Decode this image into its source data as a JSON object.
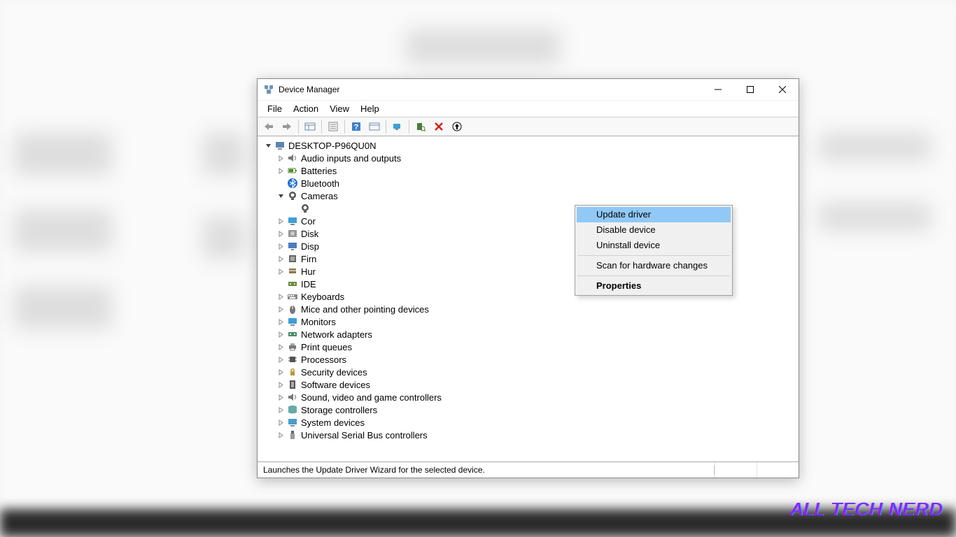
{
  "window": {
    "title": "Device Manager"
  },
  "menu": {
    "file": "File",
    "action": "Action",
    "view": "View",
    "help": "Help"
  },
  "root": {
    "label": "DESKTOP-P96QU0N"
  },
  "categories": [
    {
      "label": "Audio inputs and outputs",
      "expander": "right",
      "icon": "audio"
    },
    {
      "label": "Batteries",
      "expander": "right",
      "icon": "battery"
    },
    {
      "label": "Bluetooth",
      "expander": "none",
      "icon": "bluetooth"
    },
    {
      "label": "Cameras",
      "expander": "down",
      "icon": "camera"
    },
    {
      "label": "Cor",
      "expander": "right",
      "icon": "monitor",
      "truncated": true
    },
    {
      "label": "Disk",
      "expander": "right",
      "icon": "disk",
      "truncated": true
    },
    {
      "label": "Disp",
      "expander": "right",
      "icon": "display",
      "truncated": true
    },
    {
      "label": "Firn",
      "expander": "right",
      "icon": "firmware",
      "truncated": true
    },
    {
      "label": "Hur",
      "expander": "right",
      "icon": "hid",
      "truncated": true
    },
    {
      "label": "IDE",
      "expander": "none",
      "icon": "ide",
      "truncated": true
    },
    {
      "label": "Keyboards",
      "expander": "right",
      "icon": "keyboard"
    },
    {
      "label": "Mice and other pointing devices",
      "expander": "right",
      "icon": "mouse"
    },
    {
      "label": "Monitors",
      "expander": "right",
      "icon": "monitor"
    },
    {
      "label": "Network adapters",
      "expander": "right",
      "icon": "network"
    },
    {
      "label": "Print queues",
      "expander": "right",
      "icon": "printer"
    },
    {
      "label": "Processors",
      "expander": "right",
      "icon": "cpu"
    },
    {
      "label": "Security devices",
      "expander": "right",
      "icon": "security"
    },
    {
      "label": "Software devices",
      "expander": "right",
      "icon": "software"
    },
    {
      "label": "Sound, video and game controllers",
      "expander": "right",
      "icon": "sound"
    },
    {
      "label": "Storage controllers",
      "expander": "right",
      "icon": "storage"
    },
    {
      "label": "System devices",
      "expander": "right",
      "icon": "system"
    },
    {
      "label": "Universal Serial Bus controllers",
      "expander": "right",
      "icon": "usb"
    }
  ],
  "camera_child_icon": "camera",
  "context_menu": {
    "update_driver": "Update driver",
    "disable_device": "Disable device",
    "uninstall_device": "Uninstall device",
    "scan_hardware": "Scan for hardware changes",
    "properties": "Properties"
  },
  "status": "Launches the Update Driver Wizard for the selected device.",
  "watermark": "ALL TECH NERD"
}
